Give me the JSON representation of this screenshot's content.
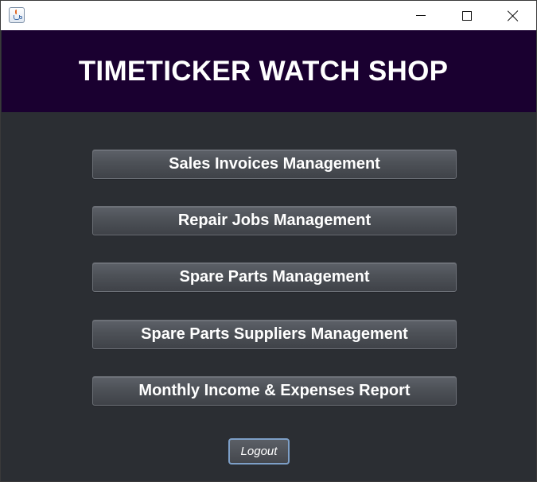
{
  "header": {
    "title": "TIMETICKER WATCH SHOP"
  },
  "menu": {
    "items": [
      {
        "label": "Sales Invoices Management"
      },
      {
        "label": "Repair Jobs Management"
      },
      {
        "label": "Spare Parts Management"
      },
      {
        "label": "Spare Parts Suppliers Management"
      },
      {
        "label": "Monthly Income & Expenses Report"
      }
    ]
  },
  "logout": {
    "label": "Logout"
  },
  "icons": {
    "app": "java-app-icon",
    "minimize": "minimize-icon",
    "maximize": "maximize-icon",
    "close": "close-icon"
  },
  "colors": {
    "header_bg": "#1a0030",
    "body_bg": "#2b2e33",
    "button_bg": "#4d5157",
    "logout_border": "#7d9fc7"
  }
}
